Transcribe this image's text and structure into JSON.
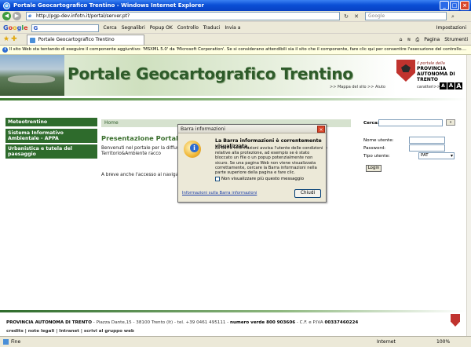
{
  "window": {
    "title": "Portale Geocartografico Trentino - Windows Internet Explorer",
    "url": "http://pgp-dev.infotn.it/portal/server.pt?",
    "search_placeholder": "Google"
  },
  "google_toolbar": {
    "logo": [
      "G",
      "o",
      "o",
      "g",
      "l",
      "e"
    ],
    "cerca": "Cerca",
    "segnalibri": "Segnalibri",
    "popup": "Popup OK",
    "controllo": "Controllo",
    "traduci": "Traduci",
    "invia": "Invia a",
    "impostazioni": "Impostazioni"
  },
  "tab": {
    "label": "Portale Geocartografico Trentino",
    "tools": [
      "Pagina",
      "Strumenti"
    ]
  },
  "infobar": {
    "text": "Il sito Web sta tentando di eseguire il componente aggiuntivo: 'MSXML 5.0' da 'Microsoft Corporation'. Se si considerano attendibili sia il sito che il componente, fare clic qui per consentire l'esecuzione del controllo...."
  },
  "header": {
    "title": "Portale Geocartografico Trentino",
    "prov_small": "il portale della",
    "prov_name": "PROVINCIA AUTONOMA DI TRENTO",
    "link_mappa": ">> Mappa del sito",
    "link_aiuto": ">> Aiuto",
    "caratteri": "caratteri>>",
    "font_sizes": [
      "A",
      "A",
      "A"
    ]
  },
  "nav": {
    "items": [
      "Meteotrentino",
      "Sistema Informativo Ambientale - APPA",
      "Urbanistica e tutela del paesaggio"
    ]
  },
  "main": {
    "breadcrumb": "Home",
    "title": "Presentazione Portale Geo",
    "para1": "Benvenuti nel portale per la diffusi                                    la Provincia Autonoma di Trento. Il Portale Territorio&Ambiente racco                                   cartografici del territorio trentino.",
    "para2": "A breve anche l'accesso ai navigato                                        ortale Territorio&Ambiente."
  },
  "login": {
    "cerca_label": "Cerca:",
    "cerca_btn": "»",
    "user_label": "Nome utente:",
    "pass_label": "Password:",
    "type_label": "Tipo utente:",
    "type_value": "PAT",
    "login_btn": "Login"
  },
  "footer": {
    "line1_bold": "PROVINCIA AUTONOMA DI TRENTO",
    "line1_rest": " - Piazza Dante,15 - 38100 Trento (It) - tel. +39 0461 495111 - ",
    "line1_bold2": "numero verde 800 903606",
    "line1_rest2": " - C.F. e P.IVA ",
    "line1_bold3": "00337460224",
    "line2": "credits | note legali | Intranet | scrivi al gruppo web"
  },
  "dialog": {
    "title": "Barra informazioni",
    "heading": "La Barra informazioni è correntemente visualizzata.",
    "text": "La Barra informazioni avvisa l'utente delle condizioni relative alla protezione, ad esempio se è stato bloccato un file o un popup potenzialmente non sicuro. Se una pagina Web non viene visualizzata correttamente, cercare la Barra informazioni nella parte superiore della pagina e fare clic.",
    "checkbox": "Non visualizzare più questo messaggio",
    "link": "Informazioni sulla Barra informazioni",
    "button": "Chiudi"
  },
  "status": {
    "left": "Fine",
    "zone": "Internet",
    "zoom": "100%"
  }
}
